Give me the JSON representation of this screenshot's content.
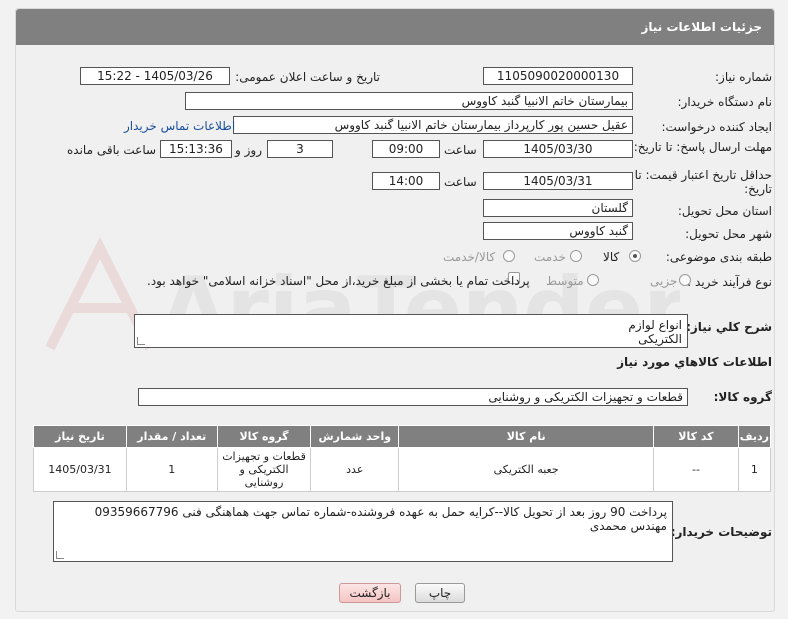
{
  "header": {
    "title": "جزئیات اطلاعات نیاز"
  },
  "fields": {
    "need_number_label": "شماره نیاز:",
    "need_number": "1105090020000130",
    "announce_label": "تاریخ و ساعت اعلان عمومی:",
    "announce_value": "1405/03/26 - 15:22",
    "buyer_org_label": "نام دستگاه خریدار:",
    "buyer_org": "بیمارستان خاتم الانبیا گنبد کاووس",
    "requester_label": "ایجاد کننده درخواست:",
    "requester": "عقیل حسین پور کارپرداز بیمارستان خاتم الانبیا گنبد کاووس",
    "contact_link": "اطلاعات تماس خریدار",
    "deadline_label": "مهلت ارسال پاسخ: تا تاریخ:",
    "deadline_date": "1405/03/30",
    "time_word": "ساعت",
    "deadline_time": "09:00",
    "days_value": "3",
    "days_and": "روز و",
    "remaining_time": "15:13:36",
    "remaining_label": "ساعت باقی مانده",
    "price_validity_label": "حداقل تاریخ اعتبار قیمت: تا تاریخ:",
    "price_validity_date": "1405/03/31",
    "price_validity_time": "14:00",
    "province_label": "استان محل تحویل:",
    "province": "گلستان",
    "city_label": "شهر محل تحویل:",
    "city": "گنبد کاووس",
    "category_label": "طبقه بندی موضوعی:",
    "category_options": [
      "کالا",
      "خدمت",
      "کالا/خدمت"
    ],
    "purchase_type_label": "نوع فرآیند خرید :",
    "purchase_options": [
      "جزیی",
      "متوسط"
    ],
    "payment_note": "پرداخت تمام یا بخشی از مبلغ خرید،از محل \"اسناد خزانه اسلامی\" خواهد بود."
  },
  "description": {
    "label": "شرح کلي نياز:",
    "text": "انواع لوازم الکتریکی طبق لیست پیوست"
  },
  "goods_section": {
    "title": "اطلاعات کالاهاي مورد نياز",
    "group_label": "گروه کالا:",
    "group_value": "قطعات و تجهیزات الکتریکی و روشنایی"
  },
  "table": {
    "headers": [
      "ردیف",
      "کد کالا",
      "نام کالا",
      "واحد شمارش",
      "گروه کالا",
      "تعداد / مقدار",
      "تاریخ نیاز"
    ],
    "rows": [
      [
        "1",
        "--",
        "جعبه الکتریکی",
        "عدد",
        "قطعات و تجهیزات الکتریکی و روشنایی",
        "1",
        "1405/03/31"
      ]
    ]
  },
  "buyer_notes": {
    "label": "توضیحات خریدار:",
    "text": "پرداخت 90 روز بعد از تحویل کالا--کرایه حمل به عهده فروشنده-شماره تماس جهت هماهنگی فنی 09359667796 مهندس محمدی"
  },
  "buttons": {
    "print": "چاپ",
    "back": "بازگشت"
  },
  "watermark": {
    "text": "AriaTender.neT"
  }
}
